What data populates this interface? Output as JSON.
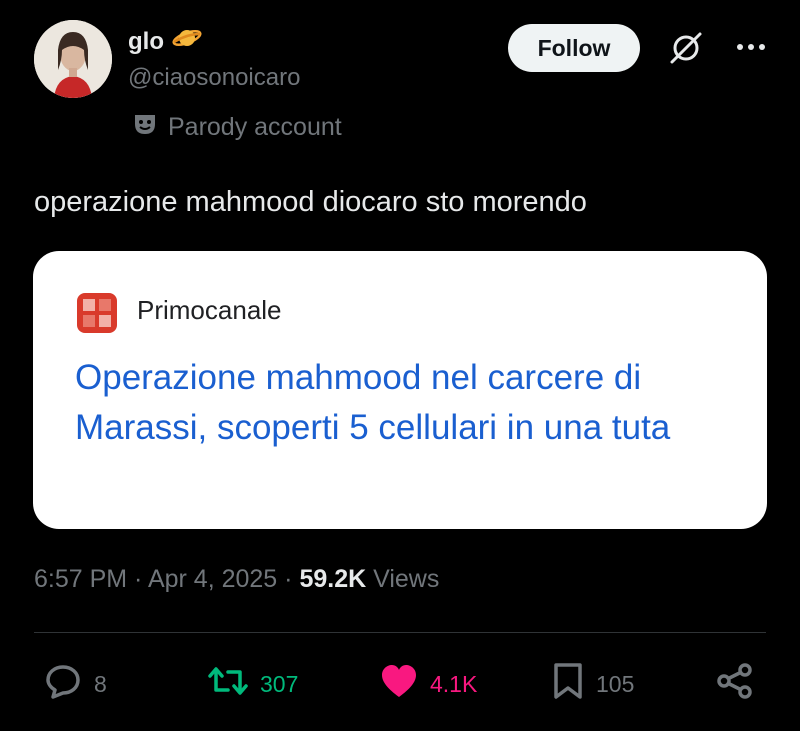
{
  "author": {
    "name": "glo",
    "handle": "@ciaosonoicaro",
    "label": "Parody account",
    "name_emoji_icon": "ringed-planet-icon"
  },
  "header": {
    "follow_label": "Follow",
    "grok_icon": "grok-icon",
    "more_icon": "more-icon"
  },
  "tweet": {
    "text": "operazione mahmood diocaro sto morendo"
  },
  "card": {
    "source": "Primocanale",
    "headline": "Operazione mahmood nel carcere di Marassi, scoperti 5 cellulari in una tuta",
    "favicon_icon": "primocanale-favicon-icon"
  },
  "meta": {
    "time": "6:57 PM",
    "sep1": " · ",
    "date": "Apr 4, 2025",
    "sep2": " · ",
    "views_count": "59.2K",
    "views_label": " Views"
  },
  "actions": {
    "replies": "8",
    "reposts": "307",
    "likes": "4.1K",
    "bookmarks": "105"
  },
  "colors": {
    "background": "#000000",
    "text": "#e7e9ea",
    "muted": "#71767b",
    "link": "#1a5fd0",
    "repost": "#00ba7c",
    "like": "#f91880"
  }
}
